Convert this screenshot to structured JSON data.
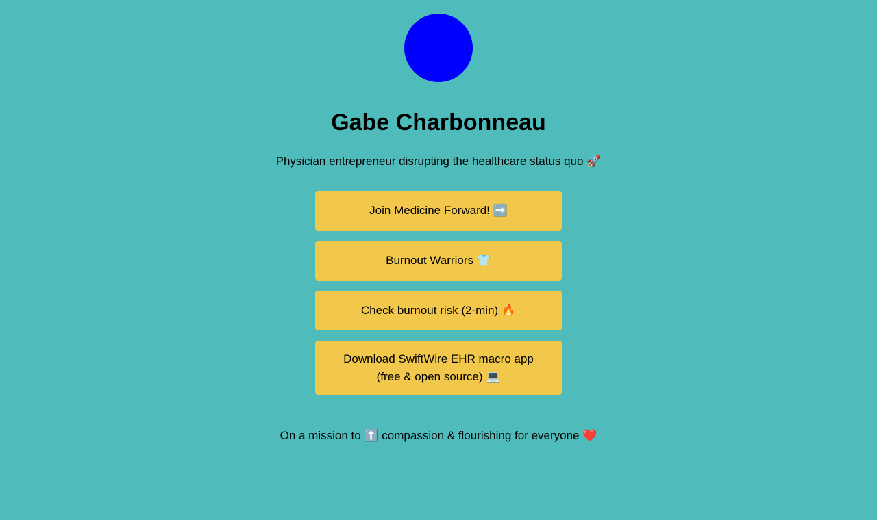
{
  "profile": {
    "avatar_color": "#0000ff",
    "name": "Gabe Charbonneau",
    "tagline": "Physician entrepreneur disrupting the healthcare status quo 🚀"
  },
  "links": [
    {
      "label": "Join Medicine Forward! ➡️"
    },
    {
      "label": "Burnout Warriors 👕"
    },
    {
      "label": "Check burnout risk (2-min) 🔥"
    },
    {
      "label": "Download SwiftWire EHR macro app (free & open source) 💻"
    }
  ],
  "footer": {
    "mission": "On a mission to ⬆️ compassion & flourishing for everyone ❤️"
  },
  "colors": {
    "background": "#4fbcbb",
    "button": "#f2c84c"
  }
}
